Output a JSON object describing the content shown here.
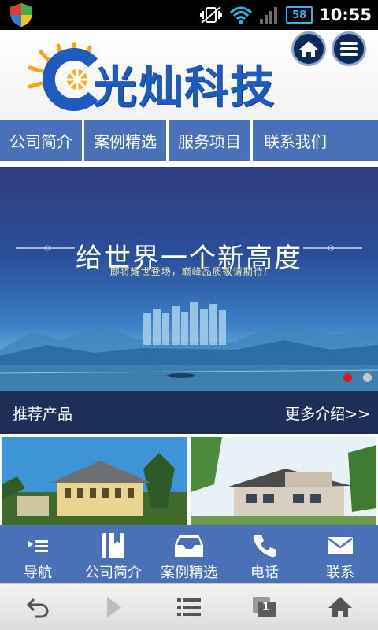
{
  "status_bar": {
    "battery": "58",
    "time": "10:55"
  },
  "header": {
    "logo_text": "光灿科技"
  },
  "top_nav": {
    "tabs": [
      {
        "label": "公司简介"
      },
      {
        "label": "案例精选"
      },
      {
        "label": "服务项目"
      },
      {
        "label": "联系我们"
      }
    ]
  },
  "banner": {
    "title": "给世界一个新高度",
    "subtitle": "即将耀世登场，巅峰品质敬请期待!",
    "slide_count": 2,
    "active_slide": 1
  },
  "section": {
    "title": "推荐产品",
    "more_link": "更多介绍>>"
  },
  "bottom_nav": {
    "items": [
      {
        "label": "导航",
        "icon": "menu-list-icon"
      },
      {
        "label": "公司简介",
        "icon": "book-icon"
      },
      {
        "label": "案例精选",
        "icon": "inbox-icon"
      },
      {
        "label": "电话",
        "icon": "phone-icon"
      },
      {
        "label": "联系",
        "icon": "mail-icon"
      }
    ]
  },
  "browser_bar": {
    "tabs_count": "1"
  },
  "colors": {
    "nav_blue": "#4a71b8",
    "section_dark": "#1e2f57",
    "logo_blue": "#1f5bbf",
    "active_dot": "#e3151a"
  }
}
